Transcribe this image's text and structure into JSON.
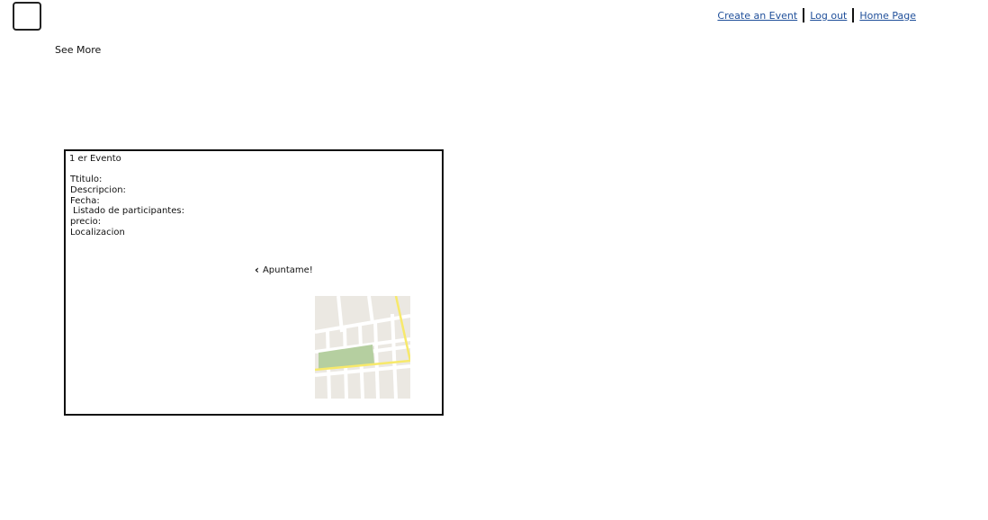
{
  "header": {
    "nav_links": [
      {
        "label": "Create an Event"
      },
      {
        "label": "Log out"
      },
      {
        "label": "Home Page"
      }
    ],
    "link_color": "#1f4f9a"
  },
  "see_more_label": "See More",
  "event_card": {
    "title": "1 er Evento",
    "fields": {
      "titulo": "Ttitulo:",
      "descripcion": "Descripcion:",
      "fecha": "Fecha:",
      "participantes": " Listado de participantes:",
      "precio": "precio:",
      "localizacion": "Localizacion"
    },
    "join_button_label": "Apuntame!",
    "join_icon": "chevron-left-icon",
    "map_icon": "map-thumbnail",
    "map_colors": {
      "ground": "#ebe8e2",
      "street": "#ffffff",
      "main_road": "#f7e96b",
      "park": "#b5cfa0"
    }
  }
}
